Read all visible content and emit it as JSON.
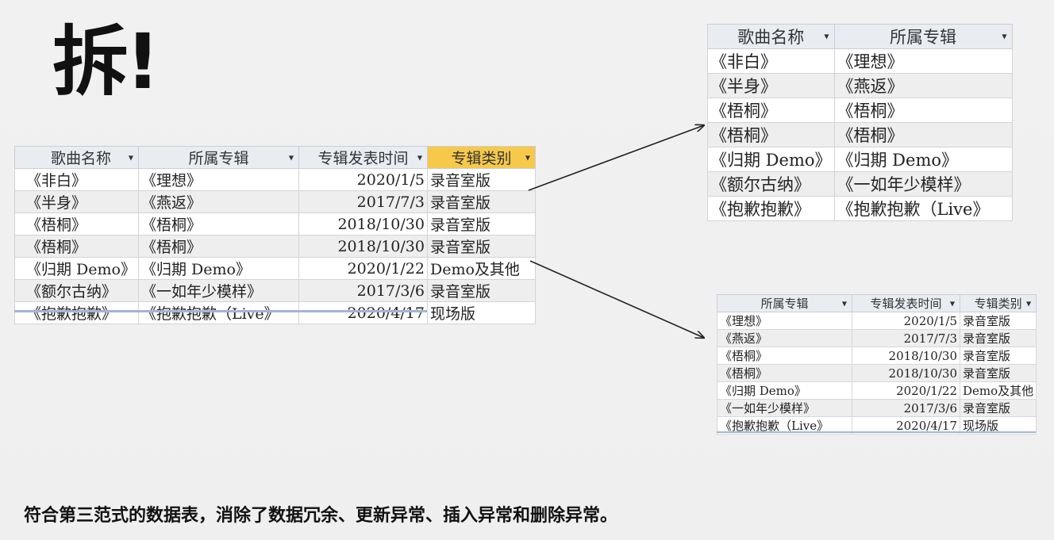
{
  "title": "拆!",
  "footer": "符合第三范式的数据表，消除了数据冗余、更新异常、插入异常和删除异常。",
  "main_table": {
    "columns": [
      "歌曲名称",
      "所属专辑",
      "专辑发表时间",
      "专辑类别"
    ],
    "rows": [
      [
        "《非白》",
        "《理想》",
        "2020/1/5",
        "录音室版"
      ],
      [
        "《半身》",
        "《燕返》",
        "2017/7/3",
        "录音室版"
      ],
      [
        "《梧桐》",
        "《梧桐》",
        "2018/10/30",
        "录音室版"
      ],
      [
        "《梧桐》",
        "《梧桐》",
        "2018/10/30",
        "录音室版"
      ],
      [
        "《归期 Demo》",
        "《归期 Demo》",
        "2020/1/22",
        "Demo及其他"
      ],
      [
        "《额尔古纳》",
        "《一如年少模样》",
        "2017/3/6",
        "录音室版"
      ],
      [
        "《抱歉抱歉》",
        "《抱歉抱歉（Live》",
        "2020/4/17",
        "现场版"
      ]
    ]
  },
  "split_table_1": {
    "columns": [
      "歌曲名称",
      "所属专辑"
    ],
    "rows": [
      [
        "《非白》",
        "《理想》"
      ],
      [
        "《半身》",
        "《燕返》"
      ],
      [
        "《梧桐》",
        "《梧桐》"
      ],
      [
        "《梧桐》",
        "《梧桐》"
      ],
      [
        "《归期 Demo》",
        "《归期 Demo》"
      ],
      [
        "《额尔古纳》",
        "《一如年少模样》"
      ],
      [
        "《抱歉抱歉》",
        "《抱歉抱歉（Live》"
      ]
    ]
  },
  "split_table_2": {
    "columns": [
      "所属专辑",
      "专辑发表时间",
      "专辑类别"
    ],
    "rows": [
      [
        "《理想》",
        "2020/1/5",
        "录音室版"
      ],
      [
        "《燕返》",
        "2017/7/3",
        "录音室版"
      ],
      [
        "《梧桐》",
        "2018/10/30",
        "录音室版"
      ],
      [
        "《梧桐》",
        "2018/10/30",
        "录音室版"
      ],
      [
        "《归期 Demo》",
        "2020/1/22",
        "Demo及其他"
      ],
      [
        "《一如年少模样》",
        "2017/3/6",
        "录音室版"
      ],
      [
        "《抱歉抱歉（Live》",
        "2020/4/17",
        "现场版"
      ]
    ]
  },
  "colors": {
    "highlight_header": "#f7c94b",
    "header_bg": "#e9edf2",
    "arrow": "#222222"
  },
  "icons": {
    "filter": "dropdown-arrow-icon"
  }
}
